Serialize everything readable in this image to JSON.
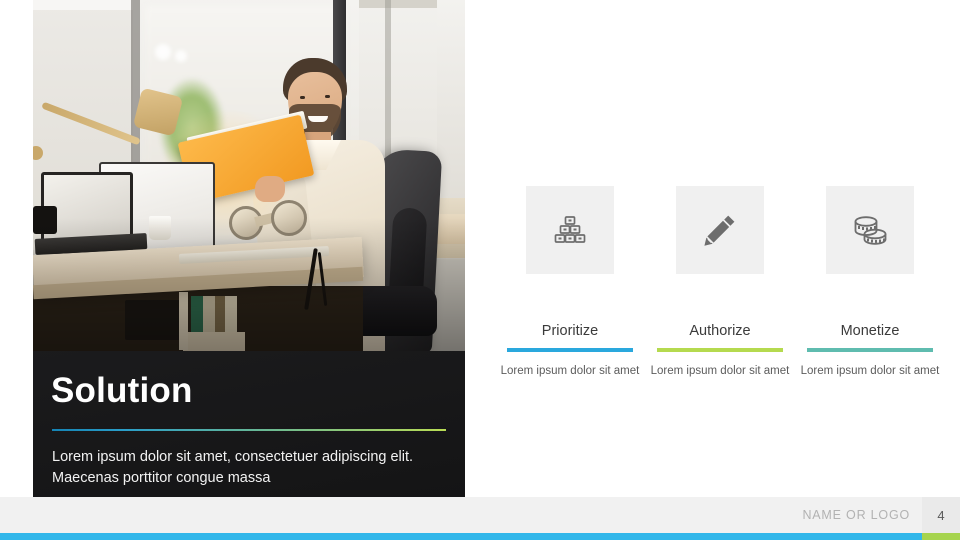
{
  "slide": {
    "left": {
      "title": "Solution",
      "body": "Lorem ipsum dolor sit amet, consectetuer adipiscing elit. Maecenas porttitor congue massa",
      "photo_alt": "office-photo-man-with-book"
    },
    "columns": [
      {
        "icon": "stacked-blocks-icon",
        "label": "Prioritize",
        "text": "Lorem ipsum dolor sit amet",
        "rule_color": "#2aa8dd"
      },
      {
        "icon": "pencil-icon",
        "label": "Authorize",
        "text": "Lorem ipsum dolor sit amet",
        "rule_color": "#b5da4f"
      },
      {
        "icon": "coins-icon",
        "label": "Monetize",
        "text": "Lorem ipsum dolor sit amet",
        "rule_color": "#5fbcaf"
      }
    ],
    "footer": {
      "logo_text": "NAME OR LOGO",
      "page_number": "4",
      "bar_color_primary": "#32b7ea",
      "bar_color_accent": "#a6d44e"
    },
    "theme": {
      "panel_background": "#1d1d1f",
      "tile_background": "#f0f0f0",
      "divider_gradient_start": "#1583b4",
      "divider_gradient_end": "#b9dc55"
    }
  }
}
